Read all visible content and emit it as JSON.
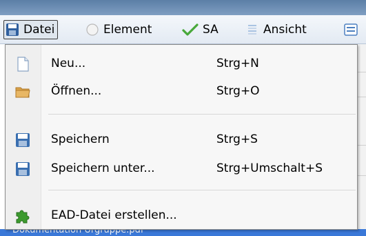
{
  "menubar": {
    "items": [
      {
        "label": "Datei",
        "icon": "floppy-icon"
      },
      {
        "label": "Element",
        "icon": "circle-icon"
      },
      {
        "label": "SA",
        "icon": "checkmark-icon"
      },
      {
        "label": "Ansicht",
        "icon": "view-list-icon"
      }
    ]
  },
  "dropdown": {
    "items": [
      {
        "label": "Neu...",
        "shortcut": "Strg+N",
        "icon": "new-document-icon"
      },
      {
        "label": "Öffnen...",
        "shortcut": "Strg+O",
        "icon": "folder-icon"
      },
      {
        "label": "Speichern",
        "shortcut": "Strg+S",
        "icon": "save-icon"
      },
      {
        "label": "Speichern unter...",
        "shortcut": "Strg+Umschalt+S",
        "icon": "save-as-icon"
      },
      {
        "label": "EAD-Datei erstellen...",
        "shortcut": "",
        "icon": "puzzle-icon"
      }
    ]
  },
  "background": {
    "partial_text": "Dokumentation Urgruppe.pdf"
  },
  "colors": {
    "menubar_bg": "#e3eaf3",
    "dropdown_bg": "#f7f7f7",
    "save_icon_blue": "#3a6fb0",
    "folder_orange": "#d9a24a",
    "puzzle_green": "#3c9a2e",
    "selection_blue": "#3a78d8"
  }
}
